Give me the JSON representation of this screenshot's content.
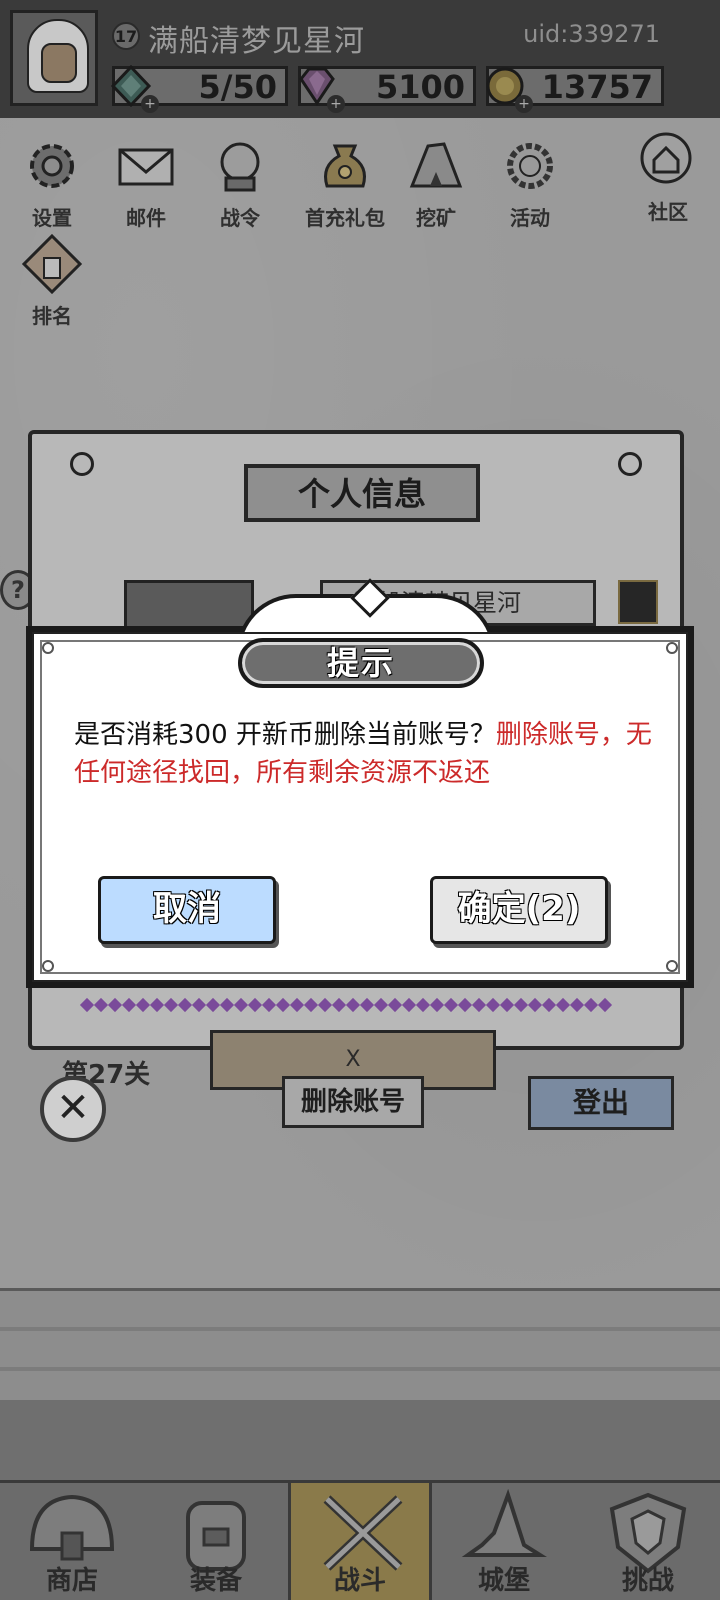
{
  "header": {
    "level": "17",
    "player_name": "满船清梦见星河",
    "uid": "uid:339271",
    "resources": [
      {
        "name": "energy",
        "icon": "teal-gem-icon",
        "value": "5/50"
      },
      {
        "name": "diamond",
        "icon": "purple-diamond-icon",
        "value": "5100"
      },
      {
        "name": "gold",
        "icon": "gold-coin-icon",
        "value": "13757"
      }
    ]
  },
  "menu": {
    "settings": "设置",
    "mail": "邮件",
    "battle_pass": "战令",
    "first_recharge": "首充礼包",
    "mining": "挖矿",
    "events": "活动",
    "community": "社区",
    "ranking": "排名"
  },
  "panel": {
    "title": "个人信息",
    "name": "满船清梦见星河",
    "stage": "第27关",
    "gem_slot": "X",
    "delete_account": "删除账号",
    "logout": "登出",
    "help": "?"
  },
  "dialog": {
    "title": "提示",
    "message_normal": "是否消耗300 开新币删除当前账号？",
    "message_warning": "删除账号，无任何途径找回，所有剩余资源不返还",
    "cancel": "取消",
    "confirm": "确定(2)"
  },
  "bottom_nav": {
    "shop": "商店",
    "equipment": "装备",
    "battle": "战斗",
    "castle": "城堡",
    "challenge": "挑战",
    "active": "battle"
  },
  "colors": {
    "warning_text": "#cc2a2a",
    "cancel_button": "#bcdcff",
    "confirm_button": "#e6e6e6",
    "logout_button": "#7a8aa0"
  }
}
